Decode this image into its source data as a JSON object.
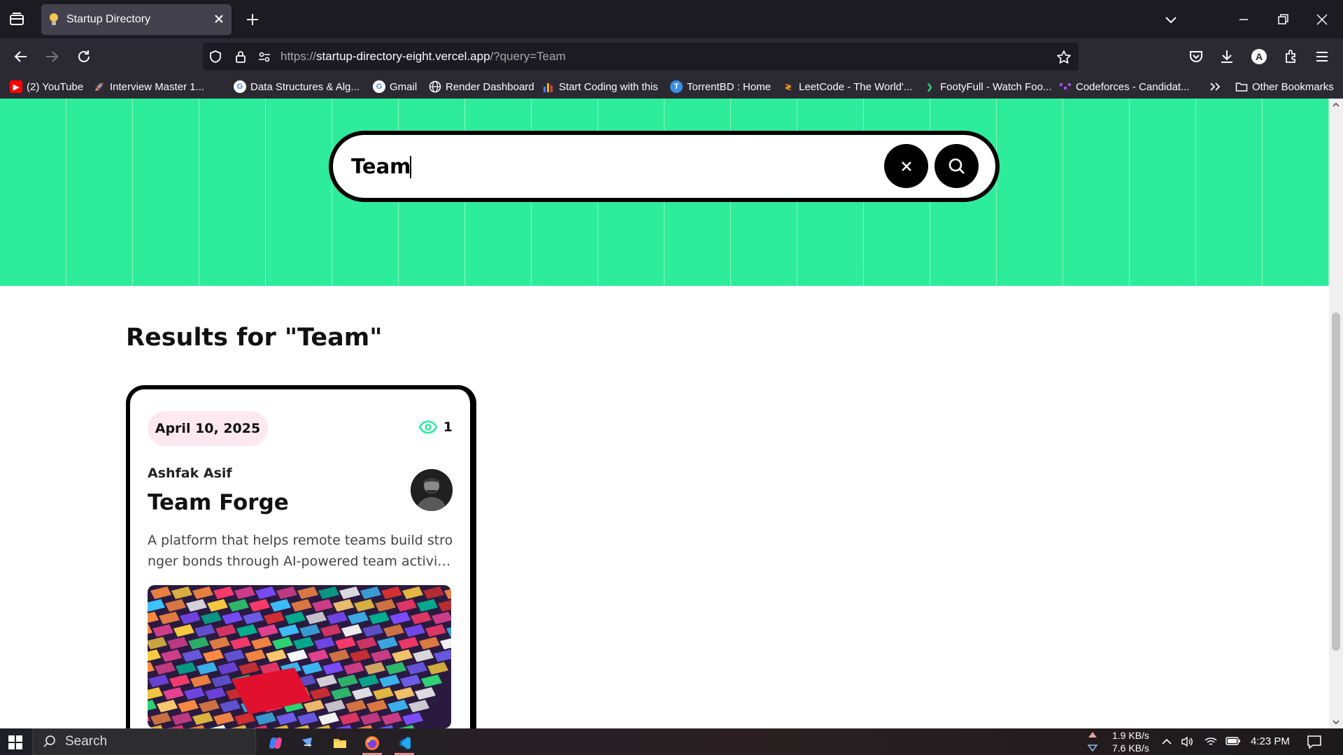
{
  "browser": {
    "tab": {
      "title": "Startup Directory"
    },
    "url": {
      "scheme": "https://",
      "host": "startup-directory-eight.vercel.app",
      "path": "/?query=Team"
    },
    "bookmarks": [
      {
        "label": "(2) YouTube",
        "icon": "youtube-icon",
        "color": "#ff0000"
      },
      {
        "label": "Interview Master 1...",
        "icon": "rocket-icon",
        "color": "#6ea8ff"
      },
      {
        "label": "Data Structures & Alg...",
        "icon": "google-icon",
        "color": "#4285f4"
      },
      {
        "label": "Gmail",
        "icon": "google-icon",
        "color": "#4285f4"
      },
      {
        "label": "Render Dashboard",
        "icon": "globe-icon",
        "color": "#cccccc"
      },
      {
        "label": "Start Coding with this",
        "icon": "bar-chart-icon",
        "color": "#f4b400"
      },
      {
        "label": "TorrentBD : Home",
        "icon": "torrent-icon",
        "color": "#3a8ee6"
      },
      {
        "label": "LeetCode - The World'...",
        "icon": "leetcode-icon",
        "color": "#ffa116"
      },
      {
        "label": "FootyFull - Watch Foo...",
        "icon": "footy-icon",
        "color": "#2ed573"
      },
      {
        "label": "Codeforces - Candidat...",
        "icon": "codeforces-icon",
        "color": "#a552d8"
      }
    ],
    "other_bookmarks": "Other Bookmarks"
  },
  "search": {
    "value": "Team"
  },
  "results": {
    "title": "Results for \"Team\"",
    "cards": [
      {
        "date": "April 10, 2025",
        "views": "1",
        "author": "Ashfak Asif",
        "title": "Team Forge",
        "description": "A platform that helps remote teams build stronger bonds through AI-powered team activities."
      }
    ]
  },
  "taskbar": {
    "search_label": "Search",
    "upload_speed": "1.9 KB/s",
    "download_speed": "7.6 KB/s",
    "time": "4:23 PM"
  },
  "colors": {
    "hero": "#2ded9d",
    "date_pill": "#ffe8f0",
    "accent": "#2ded9d"
  }
}
